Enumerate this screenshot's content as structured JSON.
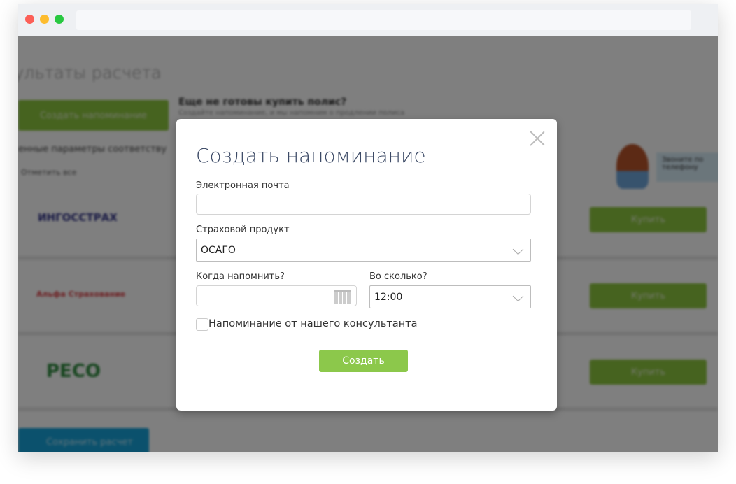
{
  "background": {
    "page_title": "ультаты расчета",
    "create_reminder_button": "Создать напоминание",
    "not_ready_title": "Еще не готовы купить полис?",
    "not_ready_text": "Создайте напоминание, и мы напомним о продлении полиса",
    "params_text": "енные параметры соответству",
    "select_all": "Отметить все",
    "consultant_bubble": "Звоните по телефону",
    "rows": [
      {
        "logo": "ИНГОССТРАХ",
        "buy_label": "Купить",
        "logo_color": "#2d2f86"
      },
      {
        "logo": "Альфа Страхование",
        "buy_label": "Купить",
        "logo_color": "#d9343b"
      },
      {
        "logo": "РЕСО",
        "buy_label": "Купить",
        "logo_color": "#2e8b3e"
      }
    ],
    "save_button": "Сохранить расчет"
  },
  "modal": {
    "title": "Создать напоминание",
    "email_label": "Электронная почта",
    "email_value": "",
    "product_label": "Страховой продукт",
    "product_value": "ОСАГО",
    "when_label": "Когда напомнить?",
    "when_value": "",
    "time_label": "Во сколько?",
    "time_value": "12:00",
    "consultant_checkbox_label": "Напоминание от нашего консультанта",
    "consultant_checked": false,
    "submit_label": "Создать"
  },
  "colors": {
    "accent_green": "#8cc84b",
    "title_color": "#3c4a66",
    "save_blue": "#17a3da"
  }
}
